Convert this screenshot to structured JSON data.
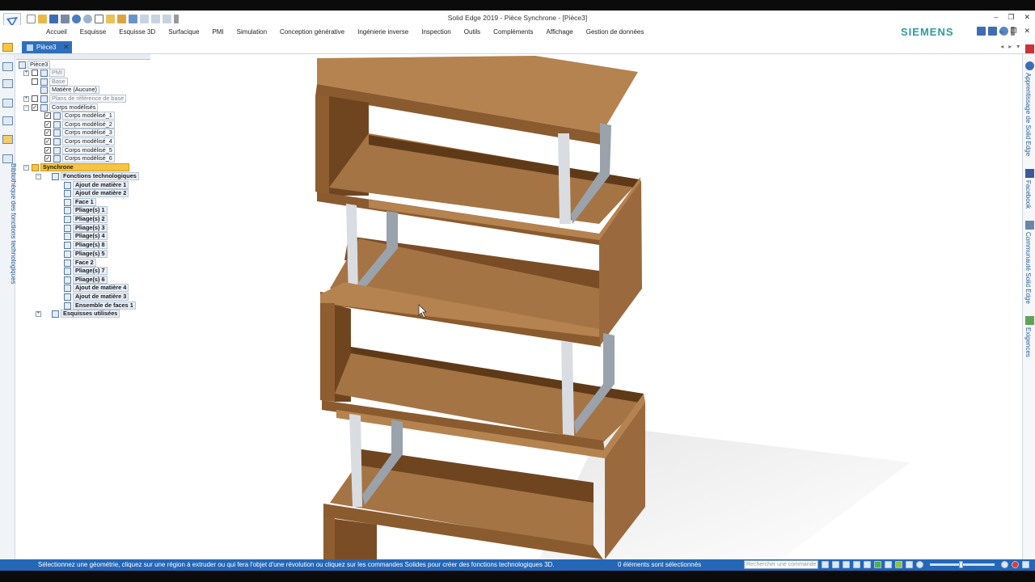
{
  "window": {
    "title": "Solid Edge 2019 - Pièce Synchrone - [Pièce3]"
  },
  "ribbon": {
    "tabs": [
      "Accueil",
      "Esquisse",
      "Esquisse 3D",
      "Surfacique",
      "PMI",
      "Simulation",
      "Conception générative",
      "Ingénierie inverse",
      "Inspection",
      "Outils",
      "Compléments",
      "Affichage",
      "Gestion de données"
    ]
  },
  "brand": "SIEMENS",
  "document_tab": {
    "label": "Pièce3"
  },
  "pathfinder": {
    "root": "Pièce3",
    "items": {
      "pmi": "PMI",
      "base": "Base",
      "matiere": "Matière (Aucune)",
      "plans": "Plans de référence de base",
      "corps": "Corps modélisés",
      "corps_1": "Corps modélisé_1",
      "corps_2": "Corps modélisé_2",
      "corps_3": "Corps modélisé_3",
      "corps_4": "Corps modélisé_4",
      "corps_5": "Corps modélisé_5",
      "corps_6": "Corps modélisé_6",
      "synchrone": "Synchrone",
      "fonctions": "Fonctions technologiques",
      "f1": "Ajout de matière 1",
      "f2": "Ajout de matière 2",
      "f3": "Face 1",
      "f4": "Pliage(s) 1",
      "f5": "Pliage(s) 2",
      "f6": "Pliage(s) 3",
      "f7": "Pliage(s) 4",
      "f8": "Pliage(s) 8",
      "f9": "Pliage(s) 5",
      "f10": "Face 2",
      "f11": "Pliage(s) 7",
      "f12": "Pliage(s) 6",
      "f13": "Ajout de matière 4",
      "f14": "Ajout de matière 3",
      "f15": "Ensemble de faces 1",
      "esquisses": "Esquisses utilisées"
    }
  },
  "left_panel_label": "Bibliothèque des fonctions technologiques",
  "right_panel": {
    "learning": "Apprentissage de Solid Edge",
    "facebook": "Facebook",
    "community": "Communauté Solid Edge",
    "requirements": "Exigences"
  },
  "status": {
    "message": "Sélectionnez une géométrie, cliquez sur une région à extruder ou qui fera l'objet d'une révolution ou cliquez sur les commandes Solides pour créer des fonctions technologiques 3D.",
    "selection": "0 éléments sont sélectionnés",
    "search_placeholder": "Rechercher une commande"
  },
  "colors": {
    "accent": "#2467b7",
    "brand": "#2e9b9b",
    "sync_highlight": "#f6c344",
    "wood": "#9a6a3e"
  }
}
